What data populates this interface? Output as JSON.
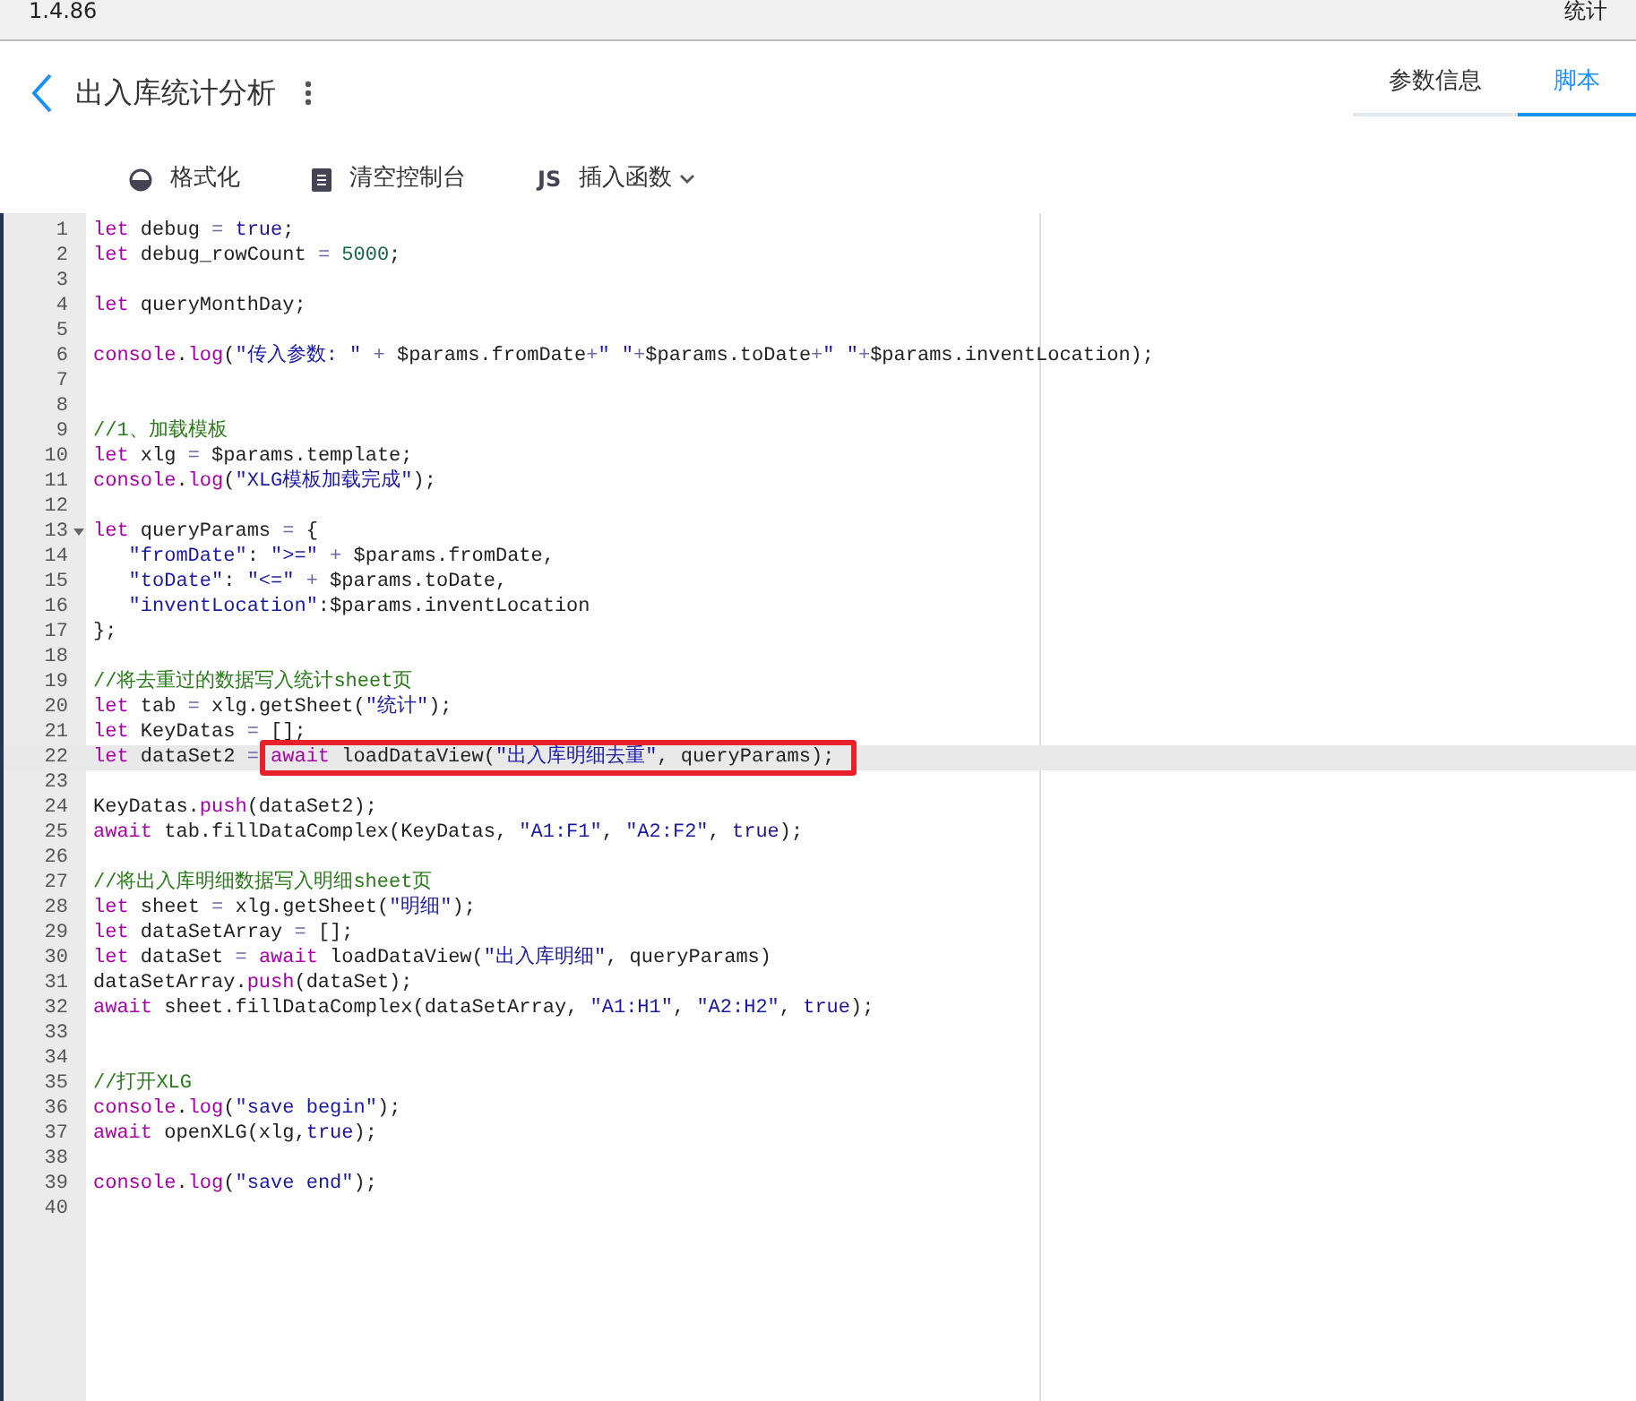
{
  "top_bar": {
    "version": "1.4.86",
    "right_text": "统计"
  },
  "header": {
    "title": "出入库统计分析"
  },
  "tabs": [
    {
      "label": "参数信息",
      "selected": false
    },
    {
      "label": "脚本",
      "selected": true
    }
  ],
  "toolbar": [
    {
      "kind": "format",
      "label": "格式化",
      "dropdown": false
    },
    {
      "kind": "clear",
      "label": "清空控制台",
      "dropdown": false
    },
    {
      "kind": "insert",
      "icon_text": "JS",
      "label": "插入函数",
      "dropdown": true
    }
  ],
  "editor": {
    "lines": [
      {
        "number": "1",
        "active": false,
        "foldable": false,
        "boxed": false,
        "code": [
          {
            "kind": "keyword",
            "text": "let"
          },
          {
            "kind": "plain",
            "text": " debug "
          },
          {
            "kind": "operator",
            "text": "= "
          },
          {
            "kind": "atom",
            "text": "true"
          },
          {
            "kind": "plain",
            "text": ";"
          }
        ]
      },
      {
        "number": "2",
        "active": false,
        "foldable": false,
        "boxed": false,
        "code": [
          {
            "kind": "keyword",
            "text": "let"
          },
          {
            "kind": "plain",
            "text": " debug_rowCount "
          },
          {
            "kind": "operator",
            "text": "= "
          },
          {
            "kind": "number",
            "text": "5000"
          },
          {
            "kind": "plain",
            "text": ";"
          }
        ]
      },
      {
        "number": "3",
        "active": false,
        "foldable": false,
        "boxed": false
      },
      {
        "number": "4",
        "active": false,
        "foldable": false,
        "boxed": false,
        "code": [
          {
            "kind": "keyword",
            "text": "let"
          },
          {
            "kind": "plain",
            "text": " queryMonthDay;"
          }
        ]
      },
      {
        "number": "5",
        "active": false,
        "foldable": false,
        "boxed": false
      },
      {
        "number": "6",
        "active": false,
        "foldable": false,
        "boxed": false,
        "code": [
          {
            "kind": "builtin",
            "text": "console"
          },
          {
            "kind": "plain",
            "text": "."
          },
          {
            "kind": "builtin",
            "text": "log"
          },
          {
            "kind": "plain",
            "text": "("
          },
          {
            "kind": "string",
            "text": "\"传入参数: \" "
          },
          {
            "kind": "operator",
            "text": "+"
          },
          {
            "kind": "plain",
            "text": " $params.fromDate"
          },
          {
            "kind": "operator",
            "text": "+"
          },
          {
            "kind": "string",
            "text": "\" \""
          },
          {
            "kind": "operator",
            "text": "+"
          },
          {
            "kind": "plain",
            "text": "$params.toDate"
          },
          {
            "kind": "operator",
            "text": "+"
          },
          {
            "kind": "string",
            "text": "\" \""
          },
          {
            "kind": "operator",
            "text": "+"
          },
          {
            "kind": "plain",
            "text": "$params.inventLocation);"
          }
        ]
      },
      {
        "number": "7",
        "active": false,
        "foldable": false,
        "boxed": false
      },
      {
        "number": "8",
        "active": false,
        "foldable": false,
        "boxed": false
      },
      {
        "number": "9",
        "active": false,
        "foldable": false,
        "boxed": false,
        "code": [
          {
            "kind": "comment",
            "text": "//1、加载模板"
          }
        ]
      },
      {
        "number": "10",
        "active": false,
        "foldable": false,
        "boxed": false,
        "code": [
          {
            "kind": "keyword",
            "text": "let"
          },
          {
            "kind": "plain",
            "text": " xlg "
          },
          {
            "kind": "operator",
            "text": "="
          },
          {
            "kind": "plain",
            "text": " $params.template;"
          }
        ]
      },
      {
        "number": "11",
        "active": false,
        "foldable": false,
        "boxed": false,
        "code": [
          {
            "kind": "builtin",
            "text": "console"
          },
          {
            "kind": "plain",
            "text": "."
          },
          {
            "kind": "builtin",
            "text": "log"
          },
          {
            "kind": "plain",
            "text": "("
          },
          {
            "kind": "string",
            "text": "\"XLG模板加载完成\""
          },
          {
            "kind": "plain",
            "text": ");"
          }
        ]
      },
      {
        "number": "12",
        "active": false,
        "foldable": false,
        "boxed": false
      },
      {
        "number": "13",
        "active": false,
        "foldable": true,
        "boxed": false,
        "code": [
          {
            "kind": "keyword",
            "text": "let"
          },
          {
            "kind": "plain",
            "text": " queryParams "
          },
          {
            "kind": "operator",
            "text": "="
          },
          {
            "kind": "plain",
            "text": " {"
          }
        ]
      },
      {
        "number": "14",
        "active": false,
        "foldable": false,
        "boxed": false,
        "code": [
          {
            "kind": "string",
            "text": "   \"fromDate\""
          },
          {
            "kind": "plain",
            "text": ": "
          },
          {
            "kind": "string",
            "text": "\">=\" "
          },
          {
            "kind": "operator",
            "text": "+"
          },
          {
            "kind": "plain",
            "text": " $params.fromDate,"
          }
        ]
      },
      {
        "number": "15",
        "active": false,
        "foldable": false,
        "boxed": false,
        "code": [
          {
            "kind": "string",
            "text": "   \"toDate\""
          },
          {
            "kind": "plain",
            "text": ": "
          },
          {
            "kind": "string",
            "text": "\"<=\" "
          },
          {
            "kind": "operator",
            "text": "+"
          },
          {
            "kind": "plain",
            "text": " $params.toDate,"
          }
        ]
      },
      {
        "number": "16",
        "active": false,
        "foldable": false,
        "boxed": false,
        "code": [
          {
            "kind": "string",
            "text": "   \"inventLocation\""
          },
          {
            "kind": "plain",
            "text": ":$params.inventLocation"
          }
        ]
      },
      {
        "number": "17",
        "active": false,
        "foldable": false,
        "boxed": false,
        "code": [
          {
            "kind": "plain",
            "text": "};"
          }
        ]
      },
      {
        "number": "18",
        "active": false,
        "foldable": false,
        "boxed": false
      },
      {
        "number": "19",
        "active": false,
        "foldable": false,
        "boxed": false,
        "code": [
          {
            "kind": "comment",
            "text": "//将去重过的数据写入统计sheet页"
          }
        ]
      },
      {
        "number": "20",
        "active": false,
        "foldable": false,
        "boxed": false,
        "code": [
          {
            "kind": "keyword",
            "text": "let"
          },
          {
            "kind": "plain",
            "text": " tab "
          },
          {
            "kind": "operator",
            "text": "="
          },
          {
            "kind": "plain",
            "text": " xlg.getSheet("
          },
          {
            "kind": "string",
            "text": "\"统计\""
          },
          {
            "kind": "plain",
            "text": ");"
          }
        ]
      },
      {
        "number": "21",
        "active": false,
        "foldable": false,
        "boxed": false,
        "code": [
          {
            "kind": "keyword",
            "text": "let"
          },
          {
            "kind": "plain",
            "text": " KeyDatas "
          },
          {
            "kind": "operator",
            "text": "="
          },
          {
            "kind": "plain",
            "text": " [];"
          }
        ]
      },
      {
        "number": "22",
        "active": true,
        "foldable": false,
        "boxed": true,
        "code": [
          {
            "kind": "keyword",
            "text": "let"
          },
          {
            "kind": "plain",
            "text": " dataSet2 "
          },
          {
            "kind": "operator",
            "text": "= "
          },
          {
            "kind": "keyword",
            "text": "await"
          },
          {
            "kind": "plain",
            "text": " loadDataView("
          },
          {
            "kind": "string",
            "text": "\"出入库明细去重\""
          },
          {
            "kind": "plain",
            "text": ", queryParams);"
          }
        ]
      },
      {
        "number": "23",
        "active": false,
        "foldable": false,
        "boxed": false
      },
      {
        "number": "24",
        "active": false,
        "foldable": false,
        "boxed": false,
        "code": [
          {
            "kind": "plain",
            "text": "KeyDatas."
          },
          {
            "kind": "builtin",
            "text": "push"
          },
          {
            "kind": "plain",
            "text": "(dataSet2);"
          }
        ]
      },
      {
        "number": "25",
        "active": false,
        "foldable": false,
        "boxed": false,
        "code": [
          {
            "kind": "keyword",
            "text": "await"
          },
          {
            "kind": "plain",
            "text": " tab.fillDataComplex(KeyDatas, "
          },
          {
            "kind": "string",
            "text": "\"A1:F1\""
          },
          {
            "kind": "plain",
            "text": ", "
          },
          {
            "kind": "string",
            "text": "\"A2:F2\""
          },
          {
            "kind": "plain",
            "text": ", "
          },
          {
            "kind": "atom",
            "text": "true"
          },
          {
            "kind": "plain",
            "text": ");"
          }
        ]
      },
      {
        "number": "26",
        "active": false,
        "foldable": false,
        "boxed": false
      },
      {
        "number": "27",
        "active": false,
        "foldable": false,
        "boxed": false,
        "code": [
          {
            "kind": "comment",
            "text": "//将出入库明细数据写入明细sheet页"
          }
        ]
      },
      {
        "number": "28",
        "active": false,
        "foldable": false,
        "boxed": false,
        "code": [
          {
            "kind": "keyword",
            "text": "let"
          },
          {
            "kind": "plain",
            "text": " sheet "
          },
          {
            "kind": "operator",
            "text": "="
          },
          {
            "kind": "plain",
            "text": " xlg.getSheet("
          },
          {
            "kind": "string",
            "text": "\"明细\""
          },
          {
            "kind": "plain",
            "text": ");"
          }
        ]
      },
      {
        "number": "29",
        "active": false,
        "foldable": false,
        "boxed": false,
        "code": [
          {
            "kind": "keyword",
            "text": "let"
          },
          {
            "kind": "plain",
            "text": " dataSetArray "
          },
          {
            "kind": "operator",
            "text": "="
          },
          {
            "kind": "plain",
            "text": " [];"
          }
        ]
      },
      {
        "number": "30",
        "active": false,
        "foldable": false,
        "boxed": false,
        "code": [
          {
            "kind": "keyword",
            "text": "let"
          },
          {
            "kind": "plain",
            "text": " dataSet "
          },
          {
            "kind": "operator",
            "text": "= "
          },
          {
            "kind": "keyword",
            "text": "await"
          },
          {
            "kind": "plain",
            "text": " loadDataView("
          },
          {
            "kind": "string",
            "text": "\"出入库明细\""
          },
          {
            "kind": "plain",
            "text": ", queryParams)"
          }
        ]
      },
      {
        "number": "31",
        "active": false,
        "foldable": false,
        "boxed": false,
        "code": [
          {
            "kind": "plain",
            "text": "dataSetArray."
          },
          {
            "kind": "builtin",
            "text": "push"
          },
          {
            "kind": "plain",
            "text": "(dataSet);"
          }
        ]
      },
      {
        "number": "32",
        "active": false,
        "foldable": false,
        "boxed": false,
        "code": [
          {
            "kind": "keyword",
            "text": "await"
          },
          {
            "kind": "plain",
            "text": " sheet.fillDataComplex(dataSetArray, "
          },
          {
            "kind": "string",
            "text": "\"A1:H1\""
          },
          {
            "kind": "plain",
            "text": ", "
          },
          {
            "kind": "string",
            "text": "\"A2:H2\""
          },
          {
            "kind": "plain",
            "text": ", "
          },
          {
            "kind": "atom",
            "text": "true"
          },
          {
            "kind": "plain",
            "text": ");"
          }
        ]
      },
      {
        "number": "33",
        "active": false,
        "foldable": false,
        "boxed": false
      },
      {
        "number": "34",
        "active": false,
        "foldable": false,
        "boxed": false
      },
      {
        "number": "35",
        "active": false,
        "foldable": false,
        "boxed": false,
        "code": [
          {
            "kind": "comment",
            "text": "//打开XLG"
          }
        ]
      },
      {
        "number": "36",
        "active": false,
        "foldable": false,
        "boxed": false,
        "code": [
          {
            "kind": "builtin",
            "text": "console"
          },
          {
            "kind": "plain",
            "text": "."
          },
          {
            "kind": "builtin",
            "text": "log"
          },
          {
            "kind": "plain",
            "text": "("
          },
          {
            "kind": "string",
            "text": "\"save begin\""
          },
          {
            "kind": "plain",
            "text": ");"
          }
        ]
      },
      {
        "number": "37",
        "active": false,
        "foldable": false,
        "boxed": false,
        "code": [
          {
            "kind": "keyword",
            "text": "await"
          },
          {
            "kind": "plain",
            "text": " openXLG(xlg,"
          },
          {
            "kind": "atom",
            "text": "true"
          },
          {
            "kind": "plain",
            "text": ");"
          }
        ]
      },
      {
        "number": "38",
        "active": false,
        "foldable": false,
        "boxed": false
      },
      {
        "number": "39",
        "active": false,
        "foldable": false,
        "boxed": false,
        "code": [
          {
            "kind": "builtin",
            "text": "console"
          },
          {
            "kind": "plain",
            "text": "."
          },
          {
            "kind": "builtin",
            "text": "log"
          },
          {
            "kind": "plain",
            "text": "("
          },
          {
            "kind": "string",
            "text": "\"save end\""
          },
          {
            "kind": "plain",
            "text": ");"
          }
        ]
      },
      {
        "number": "40",
        "active": false,
        "foldable": false,
        "boxed": false
      }
    ]
  }
}
